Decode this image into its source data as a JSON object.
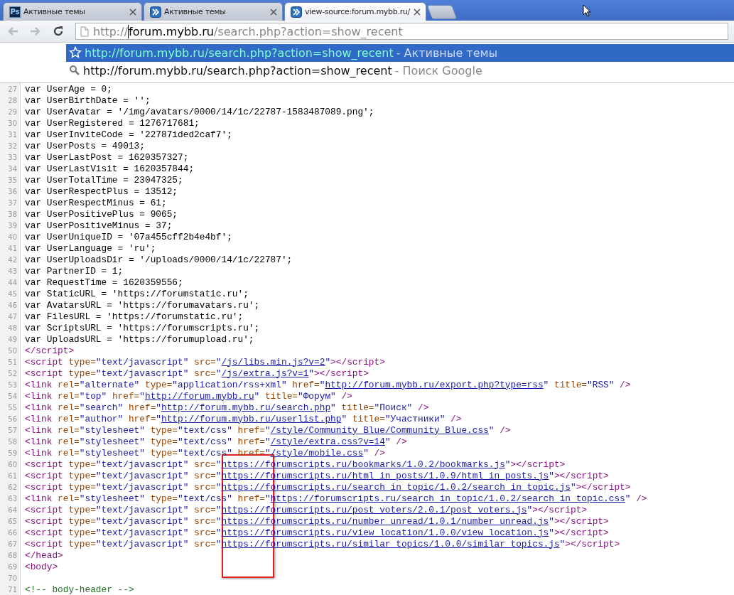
{
  "tabs": [
    {
      "title": "Активные темы",
      "icon": {
        "kind": "app",
        "text": "Ps"
      },
      "selected": false
    },
    {
      "title": "Активные темы",
      "icon": {
        "kind": "chevrons"
      },
      "selected": false
    },
    {
      "title": "view-source:forum.mybb.ru/",
      "icon": {
        "kind": "chevrons"
      },
      "selected": true
    }
  ],
  "address": {
    "scheme": "http://",
    "host": "forum.mybb.ru",
    "path": "/search.php?action=show_recent"
  },
  "suggestions": [
    {
      "kind": "history",
      "url": "http://forum.mybb.ru/search.php?action=show_recent",
      "description": "- Активные темы",
      "selected": true
    },
    {
      "kind": "search",
      "url": "http://forum.mybb.ru/search.php?action=show_recent",
      "description": "- Поиск Google",
      "selected": false
    }
  ],
  "source_lines": [
    {
      "number": "27",
      "tokens": [
        {
          "kind": "text",
          "text": "var UserAge = 0;"
        }
      ]
    },
    {
      "number": "28",
      "tokens": [
        {
          "kind": "text",
          "text": "var UserBirthDate = '';"
        }
      ]
    },
    {
      "number": "29",
      "tokens": [
        {
          "kind": "text",
          "text": "var UserAvatar = '/img/avatars/0000/14/1c/22787-1583487089.png';"
        }
      ]
    },
    {
      "number": "30",
      "tokens": [
        {
          "kind": "text",
          "text": "var UserRegistered = 1276717681;"
        }
      ]
    },
    {
      "number": "31",
      "tokens": [
        {
          "kind": "text",
          "text": "var UserInviteCode = '22787ided2caf7';"
        }
      ]
    },
    {
      "number": "32",
      "tokens": [
        {
          "kind": "text",
          "text": "var UserPosts = 49013;"
        }
      ]
    },
    {
      "number": "33",
      "tokens": [
        {
          "kind": "text",
          "text": "var UserLastPost = 1620357327;"
        }
      ]
    },
    {
      "number": "34",
      "tokens": [
        {
          "kind": "text",
          "text": "var UserLastVisit = 1620357844;"
        }
      ]
    },
    {
      "number": "35",
      "tokens": [
        {
          "kind": "text",
          "text": "var UserTotalTime = 23047325;"
        }
      ]
    },
    {
      "number": "36",
      "tokens": [
        {
          "kind": "text",
          "text": "var UserRespectPlus = 13512;"
        }
      ]
    },
    {
      "number": "37",
      "tokens": [
        {
          "kind": "text",
          "text": "var UserRespectMinus = 61;"
        }
      ]
    },
    {
      "number": "38",
      "tokens": [
        {
          "kind": "text",
          "text": "var UserPositivePlus = 9065;"
        }
      ]
    },
    {
      "number": "39",
      "tokens": [
        {
          "kind": "text",
          "text": "var UserPositiveMinus = 37;"
        }
      ]
    },
    {
      "number": "40",
      "tokens": [
        {
          "kind": "text",
          "text": "var UserUniqueID = '07a455cff2b4e4bf';"
        }
      ]
    },
    {
      "number": "41",
      "tokens": [
        {
          "kind": "text",
          "text": "var UserLanguage = 'ru';"
        }
      ]
    },
    {
      "number": "42",
      "tokens": [
        {
          "kind": "text",
          "text": "var UserUploadsDir = '/uploads/0000/14/1c/22787';"
        }
      ]
    },
    {
      "number": "43",
      "tokens": [
        {
          "kind": "text",
          "text": "var PartnerID = 1;"
        }
      ]
    },
    {
      "number": "44",
      "tokens": [
        {
          "kind": "text",
          "text": "var RequestTime = 1620359556;"
        }
      ]
    },
    {
      "number": "45",
      "tokens": [
        {
          "kind": "text",
          "text": "var StaticURL = 'https://forumstatic.ru';"
        }
      ]
    },
    {
      "number": "46",
      "tokens": [
        {
          "kind": "text",
          "text": "var AvatarsURL = 'https://forumavatars.ru';"
        }
      ]
    },
    {
      "number": "47",
      "tokens": [
        {
          "kind": "text",
          "text": "var FilesURL = 'https://forumstatic.ru';"
        }
      ]
    },
    {
      "number": "48",
      "tokens": [
        {
          "kind": "text",
          "text": "var ScriptsURL = 'https://forumscripts.ru';"
        }
      ]
    },
    {
      "number": "49",
      "tokens": [
        {
          "kind": "text",
          "text": "var UploadsURL = 'https://forumupload.ru';"
        }
      ]
    },
    {
      "number": "50",
      "tokens": [
        {
          "kind": "tag",
          "text": "</script>"
        }
      ]
    },
    {
      "number": "51",
      "tokens": [
        {
          "kind": "tag",
          "text": "<script "
        },
        {
          "kind": "attr",
          "text": "type="
        },
        {
          "kind": "value",
          "text": "\"text/javascript\" "
        },
        {
          "kind": "attr",
          "text": "src="
        },
        {
          "kind": "value",
          "text": "\""
        },
        {
          "kind": "link",
          "text": "/js/libs.min.js?v=2"
        },
        {
          "kind": "value",
          "text": "\""
        },
        {
          "kind": "tag",
          "text": "></script>"
        }
      ]
    },
    {
      "number": "52",
      "tokens": [
        {
          "kind": "tag",
          "text": "<script "
        },
        {
          "kind": "attr",
          "text": "type="
        },
        {
          "kind": "value",
          "text": "\"text/javascript\" "
        },
        {
          "kind": "attr",
          "text": "src="
        },
        {
          "kind": "value",
          "text": "\""
        },
        {
          "kind": "link",
          "text": "/js/extra.js?v=1"
        },
        {
          "kind": "value",
          "text": "\""
        },
        {
          "kind": "tag",
          "text": "></script>"
        }
      ]
    },
    {
      "number": "53",
      "tokens": [
        {
          "kind": "tag",
          "text": "<link "
        },
        {
          "kind": "attr",
          "text": "rel="
        },
        {
          "kind": "value",
          "text": "\"alternate\" "
        },
        {
          "kind": "attr",
          "text": "type="
        },
        {
          "kind": "value",
          "text": "\"application/rss+xml\" "
        },
        {
          "kind": "attr",
          "text": "href="
        },
        {
          "kind": "value",
          "text": "\""
        },
        {
          "kind": "link",
          "text": "http://forum.mybb.ru/export.php?type=rss"
        },
        {
          "kind": "value",
          "text": "\" "
        },
        {
          "kind": "attr",
          "text": "title="
        },
        {
          "kind": "value",
          "text": "\"RSS\" "
        },
        {
          "kind": "tag",
          "text": "/>"
        }
      ]
    },
    {
      "number": "54",
      "tokens": [
        {
          "kind": "tag",
          "text": "<link "
        },
        {
          "kind": "attr",
          "text": "rel="
        },
        {
          "kind": "value",
          "text": "\"top\" "
        },
        {
          "kind": "attr",
          "text": "href="
        },
        {
          "kind": "value",
          "text": "\""
        },
        {
          "kind": "link",
          "text": "http://forum.mybb.ru"
        },
        {
          "kind": "value",
          "text": "\" "
        },
        {
          "kind": "attr",
          "text": "title="
        },
        {
          "kind": "value",
          "text": "\"Форум\" "
        },
        {
          "kind": "tag",
          "text": "/>"
        }
      ]
    },
    {
      "number": "55",
      "tokens": [
        {
          "kind": "tag",
          "text": "<link "
        },
        {
          "kind": "attr",
          "text": "rel="
        },
        {
          "kind": "value",
          "text": "\"search\" "
        },
        {
          "kind": "attr",
          "text": "href="
        },
        {
          "kind": "value",
          "text": "\""
        },
        {
          "kind": "link",
          "text": "http://forum.mybb.ru/search.php"
        },
        {
          "kind": "value",
          "text": "\" "
        },
        {
          "kind": "attr",
          "text": "title="
        },
        {
          "kind": "value",
          "text": "\"Поиск\" "
        },
        {
          "kind": "tag",
          "text": "/>"
        }
      ]
    },
    {
      "number": "56",
      "tokens": [
        {
          "kind": "tag",
          "text": "<link "
        },
        {
          "kind": "attr",
          "text": "rel="
        },
        {
          "kind": "value",
          "text": "\"author\" "
        },
        {
          "kind": "attr",
          "text": "href="
        },
        {
          "kind": "value",
          "text": "\""
        },
        {
          "kind": "link",
          "text": "http://forum.mybb.ru/userlist.php"
        },
        {
          "kind": "value",
          "text": "\" "
        },
        {
          "kind": "attr",
          "text": "title="
        },
        {
          "kind": "value",
          "text": "\"Участники\" "
        },
        {
          "kind": "tag",
          "text": "/>"
        }
      ]
    },
    {
      "number": "57",
      "tokens": [
        {
          "kind": "tag",
          "text": "<link "
        },
        {
          "kind": "attr",
          "text": "rel="
        },
        {
          "kind": "value",
          "text": "\"stylesheet\" "
        },
        {
          "kind": "attr",
          "text": "type="
        },
        {
          "kind": "value",
          "text": "\"text/css\" "
        },
        {
          "kind": "attr",
          "text": "href="
        },
        {
          "kind": "value",
          "text": "\""
        },
        {
          "kind": "link",
          "text": "/style/Community_Blue/Community_Blue.css"
        },
        {
          "kind": "value",
          "text": "\" "
        },
        {
          "kind": "tag",
          "text": "/>"
        }
      ]
    },
    {
      "number": "58",
      "tokens": [
        {
          "kind": "tag",
          "text": "<link "
        },
        {
          "kind": "attr",
          "text": "rel="
        },
        {
          "kind": "value",
          "text": "\"stylesheet\" "
        },
        {
          "kind": "attr",
          "text": "type="
        },
        {
          "kind": "value",
          "text": "\"text/css\" "
        },
        {
          "kind": "attr",
          "text": "href="
        },
        {
          "kind": "value",
          "text": "\""
        },
        {
          "kind": "link",
          "text": "/style/extra.css?v=14"
        },
        {
          "kind": "value",
          "text": "\" "
        },
        {
          "kind": "tag",
          "text": "/>"
        }
      ]
    },
    {
      "number": "59",
      "tokens": [
        {
          "kind": "tag",
          "text": "<link "
        },
        {
          "kind": "attr",
          "text": "rel="
        },
        {
          "kind": "value",
          "text": "\"stylesheet\" "
        },
        {
          "kind": "attr",
          "text": "type="
        },
        {
          "kind": "value",
          "text": "\"text/css\" "
        },
        {
          "kind": "attr",
          "text": "href="
        },
        {
          "kind": "value",
          "text": "\""
        },
        {
          "kind": "link",
          "text": "/style/mobile.css"
        },
        {
          "kind": "value",
          "text": "\" "
        },
        {
          "kind": "tag",
          "text": "/>"
        }
      ]
    },
    {
      "number": "60",
      "tokens": [
        {
          "kind": "tag",
          "text": "<script "
        },
        {
          "kind": "attr",
          "text": "type="
        },
        {
          "kind": "value",
          "text": "\"text/javascript\" "
        },
        {
          "kind": "attr",
          "text": "src="
        },
        {
          "kind": "value",
          "text": "\""
        },
        {
          "kind": "link",
          "text": "https://forumscripts.ru/bookmarks/1.0.2/bookmarks.js"
        },
        {
          "kind": "value",
          "text": "\""
        },
        {
          "kind": "tag",
          "text": "></script>"
        }
      ]
    },
    {
      "number": "61",
      "tokens": [
        {
          "kind": "tag",
          "text": "<script "
        },
        {
          "kind": "attr",
          "text": "type="
        },
        {
          "kind": "value",
          "text": "\"text/javascript\" "
        },
        {
          "kind": "attr",
          "text": "src="
        },
        {
          "kind": "value",
          "text": "\""
        },
        {
          "kind": "link",
          "text": "https://forumscripts.ru/html_in_posts/1.0.9/html_in_posts.js"
        },
        {
          "kind": "value",
          "text": "\""
        },
        {
          "kind": "tag",
          "text": "></script>"
        }
      ]
    },
    {
      "number": "62",
      "tokens": [
        {
          "kind": "tag",
          "text": "<script "
        },
        {
          "kind": "attr",
          "text": "type="
        },
        {
          "kind": "value",
          "text": "\"text/javascript\" "
        },
        {
          "kind": "attr",
          "text": "src="
        },
        {
          "kind": "value",
          "text": "\""
        },
        {
          "kind": "link",
          "text": "https://forumscripts.ru/search_in_topic/1.0.2/search_in_topic.js"
        },
        {
          "kind": "value",
          "text": "\""
        },
        {
          "kind": "tag",
          "text": "></script>"
        }
      ]
    },
    {
      "number": "63",
      "tokens": [
        {
          "kind": "tag",
          "text": "<link "
        },
        {
          "kind": "attr",
          "text": "rel="
        },
        {
          "kind": "value",
          "text": "\"stylesheet\" "
        },
        {
          "kind": "attr",
          "text": "type="
        },
        {
          "kind": "value",
          "text": "\"text/css\" "
        },
        {
          "kind": "attr",
          "text": "href="
        },
        {
          "kind": "value",
          "text": "\""
        },
        {
          "kind": "link",
          "text": "https://forumscripts.ru/search_in_topic/1.0.2/search_in_topic.css"
        },
        {
          "kind": "value",
          "text": "\" "
        },
        {
          "kind": "tag",
          "text": "/>"
        }
      ]
    },
    {
      "number": "64",
      "tokens": [
        {
          "kind": "tag",
          "text": "<script "
        },
        {
          "kind": "attr",
          "text": "type="
        },
        {
          "kind": "value",
          "text": "\"text/javascript\" "
        },
        {
          "kind": "attr",
          "text": "src="
        },
        {
          "kind": "value",
          "text": "\""
        },
        {
          "kind": "link",
          "text": "https://forumscripts.ru/post_voters/2.0.1/post_voters.js"
        },
        {
          "kind": "value",
          "text": "\""
        },
        {
          "kind": "tag",
          "text": "></script>"
        }
      ]
    },
    {
      "number": "65",
      "tokens": [
        {
          "kind": "tag",
          "text": "<script "
        },
        {
          "kind": "attr",
          "text": "type="
        },
        {
          "kind": "value",
          "text": "\"text/javascript\" "
        },
        {
          "kind": "attr",
          "text": "src="
        },
        {
          "kind": "value",
          "text": "\""
        },
        {
          "kind": "link",
          "text": "https://forumscripts.ru/number_unread/1.0.1/number_unread.js"
        },
        {
          "kind": "value",
          "text": "\""
        },
        {
          "kind": "tag",
          "text": "></script>"
        }
      ]
    },
    {
      "number": "66",
      "tokens": [
        {
          "kind": "tag",
          "text": "<script "
        },
        {
          "kind": "attr",
          "text": "type="
        },
        {
          "kind": "value",
          "text": "\"text/javascript\" "
        },
        {
          "kind": "attr",
          "text": "src="
        },
        {
          "kind": "value",
          "text": "\""
        },
        {
          "kind": "link",
          "text": "https://forumscripts.ru/view_location/1.0.0/view_location.js"
        },
        {
          "kind": "value",
          "text": "\""
        },
        {
          "kind": "tag",
          "text": "></script>"
        }
      ]
    },
    {
      "number": "67",
      "tokens": [
        {
          "kind": "tag",
          "text": "<script "
        },
        {
          "kind": "attr",
          "text": "type="
        },
        {
          "kind": "value",
          "text": "\"text/javascript\" "
        },
        {
          "kind": "attr",
          "text": "src="
        },
        {
          "kind": "value",
          "text": "\""
        },
        {
          "kind": "link",
          "text": "https://forumscripts.ru/similar_topics/1.0.0/similar_topics.js"
        },
        {
          "kind": "value",
          "text": "\""
        },
        {
          "kind": "tag",
          "text": "></script>"
        }
      ]
    },
    {
      "number": "68",
      "tokens": [
        {
          "kind": "tag",
          "text": "</head>"
        }
      ]
    },
    {
      "number": "69",
      "tokens": [
        {
          "kind": "tag",
          "text": "<body>"
        }
      ]
    },
    {
      "number": "70"
    },
    {
      "number": "71",
      "tokens": [
        {
          "kind": "comment",
          "text": "<!-- body-header -->"
        }
      ]
    }
  ]
}
